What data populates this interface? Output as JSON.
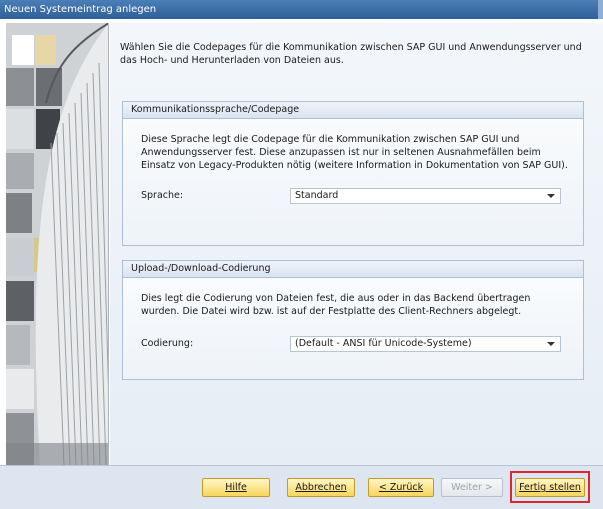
{
  "window": {
    "title": "Neuen Systemeintrag anlegen"
  },
  "intro_text": "Wählen Sie die Codepages für die Kommunikation zwischen SAP GUI und Anwendungsserver und das Hoch- und Herunterladen von Dateien aus.",
  "group_communication": {
    "header": "Kommunikationssprache/Codepage",
    "description": "Diese Sprache legt die Codepage für die Kommunikation zwischen SAP GUI und Anwendungsserver fest. Diese anzupassen ist nur in seltenen Ausnahmefällen beim Einsatz von Legacy-Produkten nötig (weitere Information in Dokumentation von SAP GUI).",
    "field_label": "Sprache:",
    "field_value": "Standard"
  },
  "group_upload": {
    "header": "Upload-/Download-Codierung",
    "description": "Dies legt die Codierung von Dateien fest, die aus oder in das Backend übertragen wurden. Die Datei wird bzw. ist auf der Festplatte des Client-Rechners abgelegt.",
    "field_label": "Codierung:",
    "field_value": "(Default - ANSI für Unicode-Systeme)"
  },
  "buttons": {
    "help": "Hilfe",
    "cancel": "Abbrechen",
    "back": "< Zurück",
    "next": "Weiter >",
    "finish": "Fertig stellen"
  },
  "colors": {
    "highlight": "#e0262b",
    "titlebar": "#2f5f96",
    "button": "#f7d65c"
  }
}
